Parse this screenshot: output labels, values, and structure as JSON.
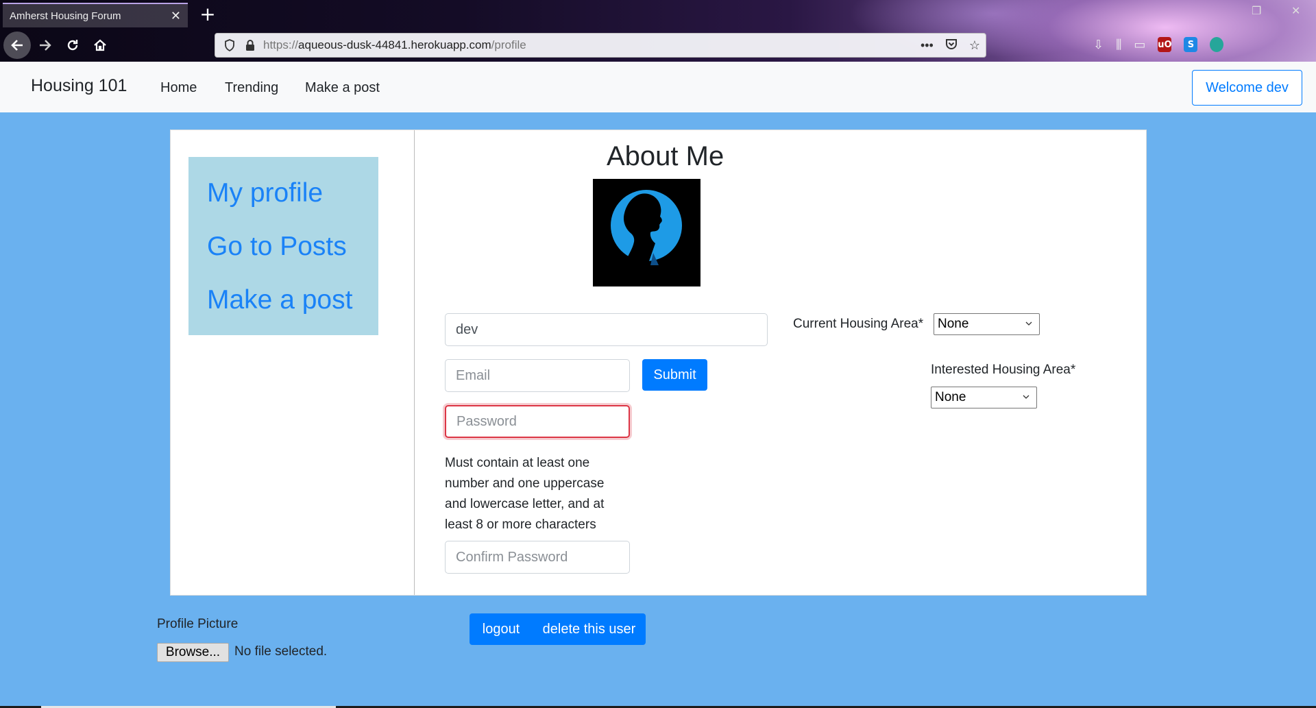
{
  "browser": {
    "tab_title": "Amherst Housing Forum",
    "url_scheme": "https://",
    "url_host": "aqueous-dusk-44841.herokuapp.com",
    "url_path": "/profile",
    "more_label": "•••"
  },
  "site_nav": {
    "brand": "Housing 101",
    "links": [
      "Home",
      "Trending",
      "Make a post"
    ],
    "welcome": "Welcome dev"
  },
  "side_menu": {
    "items": [
      "My profile",
      "Go to Posts",
      "Make a post"
    ]
  },
  "profile": {
    "title": "About Me",
    "username_value": "dev",
    "email_placeholder": "Email",
    "password_placeholder": "Password",
    "confirm_placeholder": "Confirm Password",
    "submit_label": "Submit",
    "password_hint": "Must contain at least one number and one uppercase and lowercase letter, and at least 8 or more characters",
    "current_area_label": "Current Housing Area*",
    "current_area_value": "None",
    "interested_area_label": "Interested Housing Area*",
    "interested_area_value": "None"
  },
  "bottom": {
    "picture_label": "Profile Picture",
    "browse_label": "Browse...",
    "file_status": "No file selected.",
    "logout_label": "logout",
    "delete_label": "delete this user"
  },
  "colors": {
    "page_bg": "#6ab1ef",
    "primary": "#007bff",
    "side_menu_bg": "#add8e6",
    "invalid": "#dc3545"
  }
}
